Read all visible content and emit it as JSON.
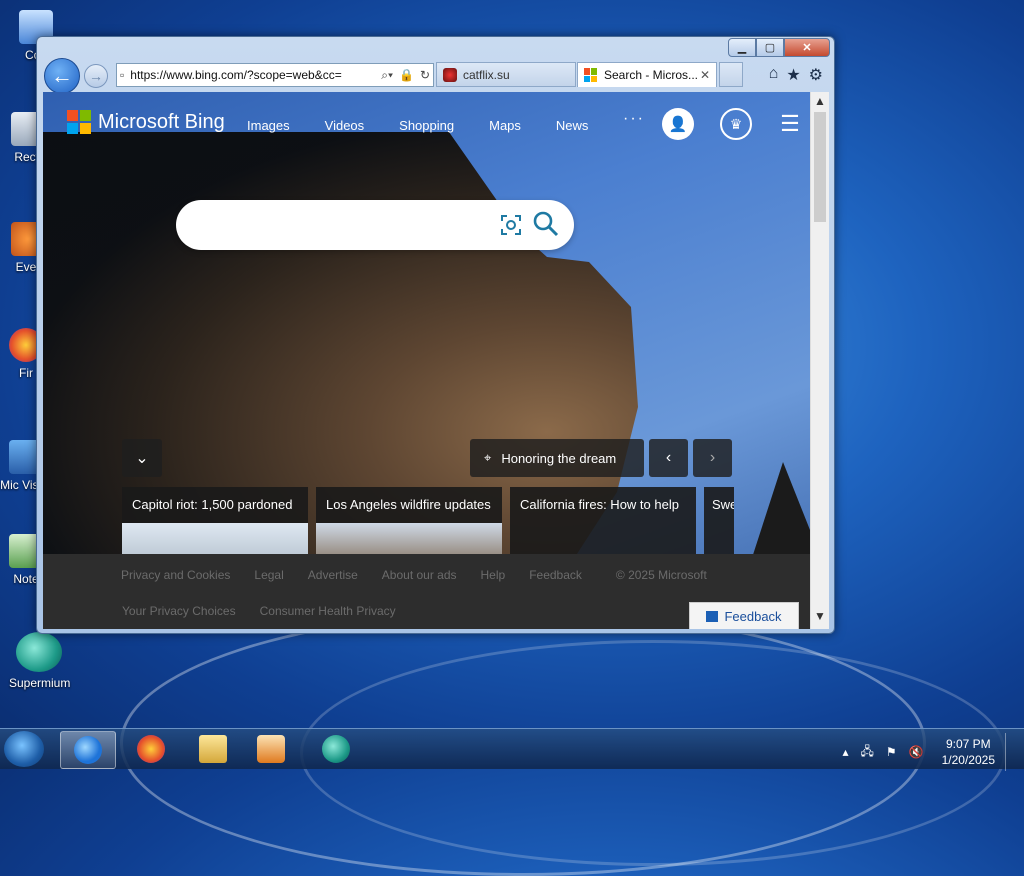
{
  "desktop": {
    "icons": [
      {
        "label": "Con"
      },
      {
        "label": "Recy"
      },
      {
        "label": "Ever"
      },
      {
        "label": "Fir"
      },
      {
        "label": "Mic Visua"
      },
      {
        "label": "Note"
      },
      {
        "label": "Supermium"
      }
    ]
  },
  "browser": {
    "address_url": "https://www.bing.com/?scope=web&cc=",
    "tabs": [
      {
        "title": "catflix.su",
        "active": false
      },
      {
        "title": "Search - Micros...",
        "active": true
      }
    ],
    "close_tab_glyph": "✕"
  },
  "bing": {
    "logo_text": "Microsoft Bing",
    "nav": [
      "Images",
      "Videos",
      "Shopping",
      "Maps",
      "News"
    ],
    "more": "···",
    "search_value": "",
    "image_caption": "Honoring the dream",
    "cards": [
      {
        "title": "Capitol riot: 1,500 pardoned"
      },
      {
        "title": "Los Angeles wildfire updates"
      },
      {
        "title": "California fires: How to help"
      },
      {
        "title": "Swe"
      }
    ],
    "footer_links_row1": [
      "Privacy and Cookies",
      "Legal",
      "Advertise",
      "About our ads",
      "Help",
      "Feedback"
    ],
    "copyright": "© 2025 Microsoft",
    "footer_links_row2": [
      "Your Privacy Choices",
      "Consumer Health Privacy"
    ],
    "feedback_button": "Feedback"
  },
  "taskbar": {
    "time": "9:07 PM",
    "date": "1/20/2025"
  },
  "colors": {
    "accent": "#1f7aa3",
    "ms_red": "#f25022",
    "ms_green": "#7fba00",
    "ms_blue": "#00a4ef",
    "ms_yellow": "#ffb900"
  }
}
